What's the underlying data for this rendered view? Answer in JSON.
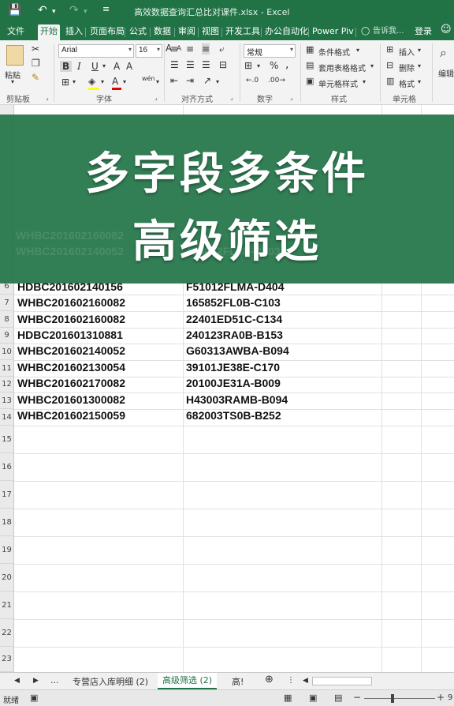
{
  "window": {
    "title": "高效数据查询汇总比对课件.xlsx - Excel",
    "undo_label": "↶",
    "redo_label": "↷"
  },
  "ribbon_tabs": [
    {
      "label": "文件"
    },
    {
      "label": "开始",
      "active": true
    },
    {
      "label": "插入"
    },
    {
      "label": "页面布局"
    },
    {
      "label": "公式"
    },
    {
      "label": "数据"
    },
    {
      "label": "审阅"
    },
    {
      "label": "视图"
    },
    {
      "label": "开发工具"
    },
    {
      "label": "办公自动化"
    },
    {
      "label": "Power Pivot"
    }
  ],
  "ribbon_extra": {
    "tell_me": "告诉我...",
    "login": "登录"
  },
  "ribbon": {
    "clipboard": {
      "paste": "粘贴",
      "label": "剪贴板"
    },
    "font": {
      "name": "Arial",
      "size": "16",
      "bold": "B",
      "italic": "I",
      "underline": "U",
      "label": "字体",
      "wen": "wén"
    },
    "alignment": {
      "label": "对齐方式"
    },
    "number": {
      "format": "常规",
      "percent": "%",
      "comma": ",",
      "label": "数字"
    },
    "styles": {
      "conditional": "条件格式",
      "table": "套用表格格式",
      "cell": "单元格样式",
      "label": "样式"
    },
    "cells": {
      "insert": "插入",
      "delete": "删除",
      "format": "格式",
      "label": "单元格"
    },
    "editing": {
      "label": "编辑"
    }
  },
  "banner": {
    "line1": "多字段多条件",
    "line2": "高级筛选"
  },
  "rows": [
    {
      "num": "6",
      "a": "HDBC201602140156",
      "b": "F51012FLMA-D404"
    },
    {
      "num": "7",
      "a": "WHBC201602160082",
      "b": "165852FL0B-C103"
    },
    {
      "num": "8",
      "a": "WHBC201602160082",
      "b": "22401ED51C-C134"
    },
    {
      "num": "9",
      "a": "HDBC201601310881",
      "b": "240123RA0B-B153"
    },
    {
      "num": "10",
      "a": "WHBC201602140052",
      "b": "G60313AWBA-B094"
    },
    {
      "num": "11",
      "a": "WHBC201602130054",
      "b": "39101JE38E-C170"
    },
    {
      "num": "12",
      "a": "WHBC201602170082",
      "b": "20100JE31A-B009"
    },
    {
      "num": "13",
      "a": "WHBC201601300082",
      "b": "H43003RAMB-B094"
    },
    {
      "num": "14",
      "a": "WHBC201602150059",
      "b": "682003TS0B-B252"
    }
  ],
  "empty_rows": [
    "15",
    "16",
    "17",
    "18",
    "19",
    "20",
    "21",
    "22",
    "23"
  ],
  "sheet_tabs": {
    "ellipsis": "...",
    "tab1": "专营店入库明细 (2)",
    "tab2": "高级筛选 (2)",
    "tab3": "高!",
    "add": "⊕"
  },
  "status": {
    "ready": "就绪",
    "zoom": "9"
  }
}
